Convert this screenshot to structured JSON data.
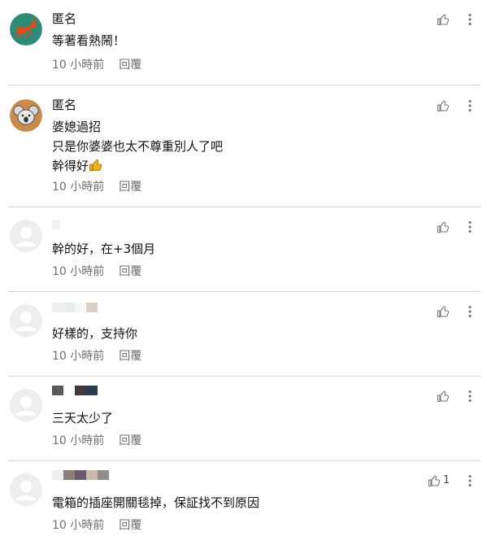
{
  "icons": {
    "like": "thumbs-up-icon",
    "more": "more-vertical-icon",
    "thumbs_emoji": "thumbs-up-emoji"
  },
  "colors": {
    "meta": "#6f6f6f",
    "divider": "#d4d4d4",
    "emoji": "#f2b21a"
  },
  "comments": [
    {
      "author": "匿名",
      "lines": [
        "等著看熱鬧！"
      ],
      "time": "10 小時前",
      "reply": "回覆",
      "likes": ""
    },
    {
      "author": "匿名",
      "lines": [
        "婆媳過招",
        "只是你婆婆也太不尊重別人了吧",
        "幹得好"
      ],
      "time": "10 小時前",
      "reply": "回覆",
      "likes": ""
    },
    {
      "author": "",
      "lines": [
        "幹的好，在+3個月"
      ],
      "time": "10 小時前",
      "reply": "回覆",
      "likes": ""
    },
    {
      "author": "",
      "lines": [
        "好樣的，支持你"
      ],
      "time": "10 小時前",
      "reply": "回覆",
      "likes": ""
    },
    {
      "author": "",
      "lines": [
        "三天太少了"
      ],
      "time": "10 小時前",
      "reply": "回覆",
      "likes": ""
    },
    {
      "author": "",
      "lines": [
        "電箱的插座開關毯掉，保証找不到原因"
      ],
      "time": "10 小時前",
      "reply": "回覆",
      "likes": "1"
    }
  ]
}
